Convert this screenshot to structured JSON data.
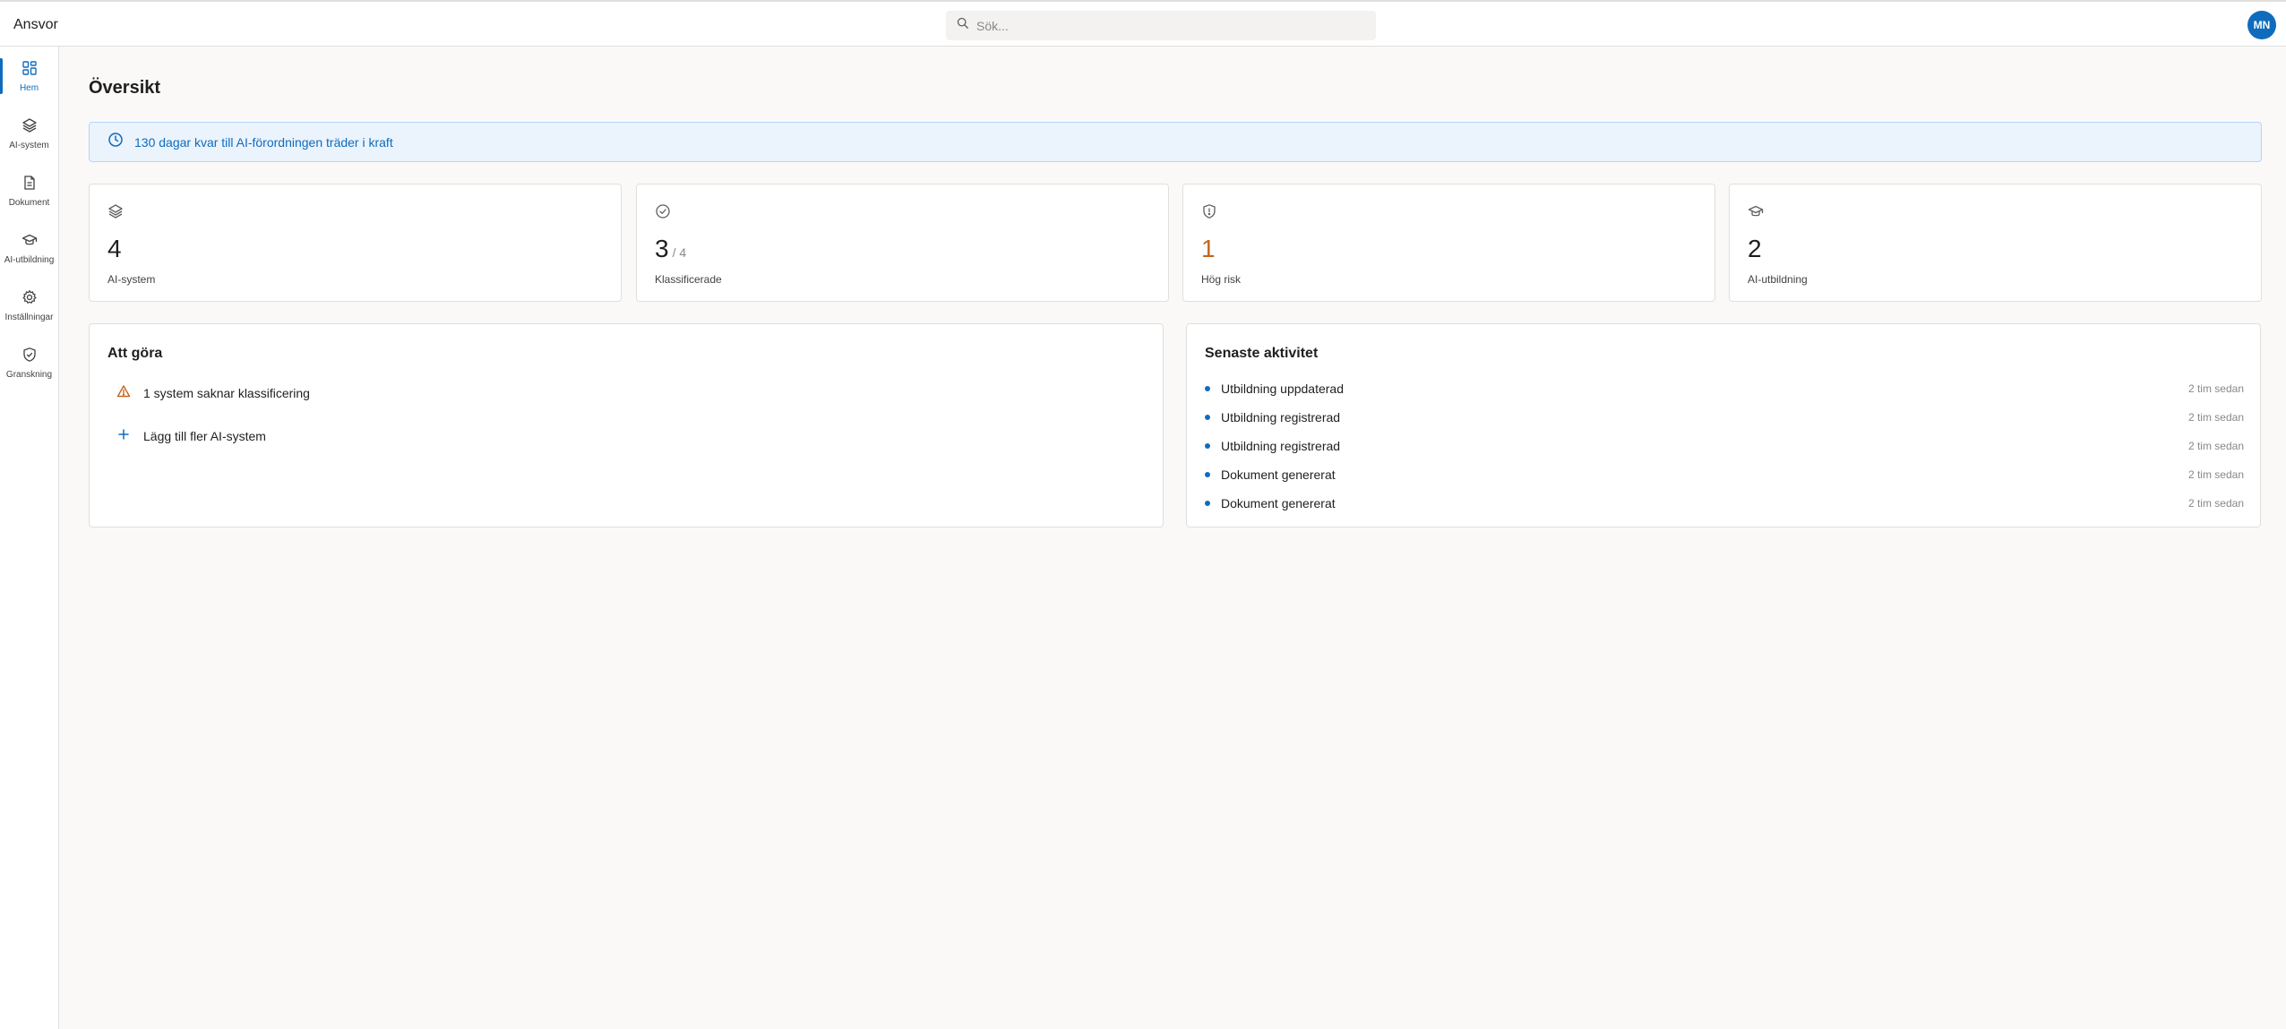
{
  "app": {
    "title": "Ansvor"
  },
  "search": {
    "placeholder": "Sök..."
  },
  "user": {
    "initials": "MN"
  },
  "sidebar": {
    "items": [
      {
        "label": "Hem",
        "icon": "grid-icon",
        "active": true
      },
      {
        "label": "AI-system",
        "icon": "layers-icon",
        "active": false
      },
      {
        "label": "Dokument",
        "icon": "document-icon",
        "active": false
      },
      {
        "label": "AI-utbildning",
        "icon": "graduation-cap-icon",
        "active": false
      },
      {
        "label": "Inställningar",
        "icon": "gear-icon",
        "active": false
      },
      {
        "label": "Granskning",
        "icon": "shield-check-icon",
        "active": false
      }
    ]
  },
  "page": {
    "title": "Översikt"
  },
  "banner": {
    "text": "130 dagar kvar till AI-förordningen träder i kraft",
    "icon": "clock-icon"
  },
  "stats": [
    {
      "value": "4",
      "sub": "",
      "label": "AI-system",
      "icon": "layers-icon"
    },
    {
      "value": "3",
      "sub": "/ 4",
      "label": "Klassificerade",
      "icon": "check-circle-icon"
    },
    {
      "value": "1",
      "sub": "",
      "label": "Hög risk",
      "icon": "shield-alert-icon"
    },
    {
      "value": "2",
      "sub": "",
      "label": "AI-utbildning",
      "icon": "graduation-cap-icon"
    }
  ],
  "todo": {
    "title": "Att göra",
    "items": [
      {
        "text": "1 system saknar klassificering",
        "icon": "warning-icon"
      },
      {
        "text": "Lägg till fler AI-system",
        "icon": "plus-icon"
      }
    ]
  },
  "activity": {
    "title": "Senaste aktivitet",
    "items": [
      {
        "text": "Utbildning uppdaterad",
        "time": "2 tim sedan"
      },
      {
        "text": "Utbildning registrerad",
        "time": "2 tim sedan"
      },
      {
        "text": "Utbildning registrerad",
        "time": "2 tim sedan"
      },
      {
        "text": "Dokument genererat",
        "time": "2 tim sedan"
      },
      {
        "text": "Dokument genererat",
        "time": "2 tim sedan"
      }
    ]
  },
  "colors": {
    "accent": "#0f6cbd",
    "warning": "#c4661f",
    "background": "#faf9f8"
  }
}
